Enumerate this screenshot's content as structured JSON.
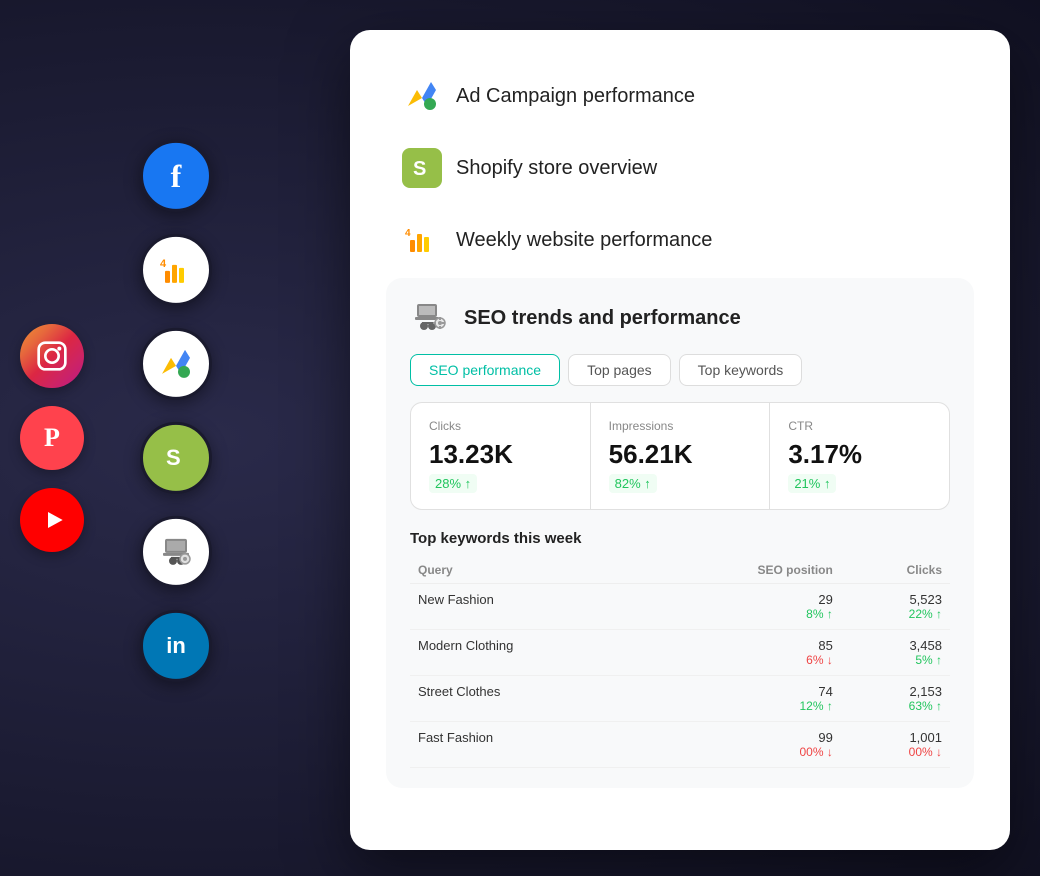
{
  "background": "#1a1a2e",
  "social_icons_col1": [
    {
      "id": "instagram",
      "emoji": "📷",
      "label": "Instagram",
      "bg": "instagram-gradient"
    },
    {
      "id": "patreon",
      "emoji": "P",
      "label": "Patreon",
      "bg": "#ff424d"
    },
    {
      "id": "youtube",
      "emoji": "▶",
      "label": "YouTube",
      "bg": "#ff0000"
    }
  ],
  "social_icons_col2": [
    {
      "id": "facebook",
      "emoji": "f",
      "label": "Facebook",
      "bg": "#1877F2"
    },
    {
      "id": "databox",
      "emoji": "4",
      "label": "Databox",
      "bg": "#ff8c00"
    },
    {
      "id": "google-ads",
      "emoji": "A",
      "label": "Google Ads",
      "bg": "white"
    },
    {
      "id": "shopify",
      "emoji": "S",
      "label": "Shopify",
      "bg": "#96bf48"
    },
    {
      "id": "seo",
      "emoji": "🔧",
      "label": "SEO Tool",
      "bg": "white"
    },
    {
      "id": "linkedin",
      "emoji": "in",
      "label": "LinkedIn",
      "bg": "#0077B5"
    }
  ],
  "menu": {
    "items": [
      {
        "id": "ad-campaign",
        "label": "Ad Campaign performance",
        "icon": "google-ads-icon"
      },
      {
        "id": "shopify",
        "label": "Shopify store overview",
        "icon": "shopify-icon"
      },
      {
        "id": "weekly-website",
        "label": "Weekly website performance",
        "icon": "databox-icon"
      }
    ]
  },
  "expanded_section": {
    "title": "SEO trends and performance",
    "icon": "seo-icon",
    "tabs": [
      {
        "id": "seo-performance",
        "label": "SEO performance",
        "active": true
      },
      {
        "id": "top-pages",
        "label": "Top pages",
        "active": false
      },
      {
        "id": "top-keywords",
        "label": "Top keywords",
        "active": false
      }
    ],
    "metrics": [
      {
        "label": "Clicks",
        "value": "13.23K",
        "change": "28% ↑",
        "change_type": "positive"
      },
      {
        "label": "Impressions",
        "value": "56.21K",
        "change": "82% ↑",
        "change_type": "positive"
      },
      {
        "label": "CTR",
        "value": "3.17%",
        "change": "21% ↑",
        "change_type": "positive"
      }
    ],
    "keywords_section": {
      "title": "Top keywords this week",
      "columns": [
        "Query",
        "SEO position",
        "Clicks"
      ],
      "rows": [
        {
          "query": "New Fashion",
          "seo_position": "29",
          "seo_change": "8% ↑",
          "seo_change_type": "positive",
          "clicks": "5,523",
          "clicks_change": "22% ↑",
          "clicks_change_type": "positive"
        },
        {
          "query": "Modern Clothing",
          "seo_position": "85",
          "seo_change": "6% ↓",
          "seo_change_type": "negative",
          "clicks": "3,458",
          "clicks_change": "5% ↑",
          "clicks_change_type": "positive"
        },
        {
          "query": "Street Clothes",
          "seo_position": "74",
          "seo_change": "12% ↑",
          "seo_change_type": "positive",
          "clicks": "2,153",
          "clicks_change": "63% ↑",
          "clicks_change_type": "positive"
        },
        {
          "query": "Fast Fashion",
          "seo_position": "99",
          "seo_change": "00% ↓",
          "seo_change_type": "negative",
          "clicks": "1,001",
          "clicks_change": "00% ↓",
          "clicks_change_type": "negative"
        }
      ]
    }
  }
}
